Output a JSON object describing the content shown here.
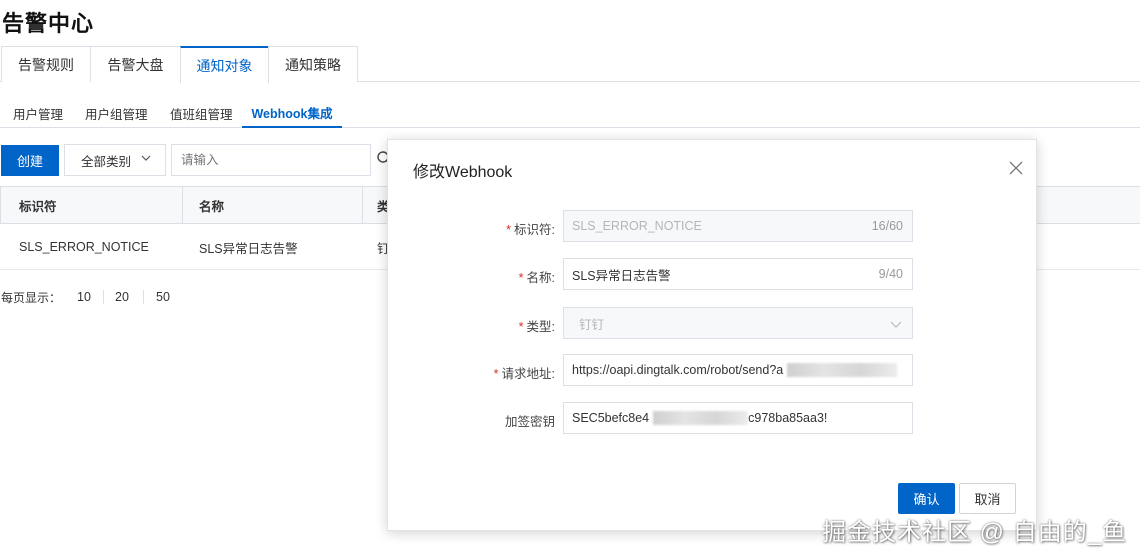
{
  "page": {
    "title": "告警中心"
  },
  "main_tabs": [
    {
      "label": "告警规则"
    },
    {
      "label": "告警大盘"
    },
    {
      "label": "通知对象",
      "active": true
    },
    {
      "label": "通知策略"
    }
  ],
  "sub_tabs": [
    {
      "label": "用户管理"
    },
    {
      "label": "用户组管理"
    },
    {
      "label": "值班组管理"
    },
    {
      "label": "Webhook集成",
      "active": true
    }
  ],
  "toolbar": {
    "create_label": "创建",
    "category_selected": "全部类别",
    "search_placeholder": "请输入"
  },
  "table": {
    "columns": [
      "标识符",
      "名称",
      "类"
    ],
    "rows": [
      [
        "SLS_ERROR_NOTICE",
        "SLS异常日志告警",
        "钉"
      ]
    ]
  },
  "pagination": {
    "label": "每页显示：",
    "options": [
      "10",
      "20",
      "50"
    ]
  },
  "dialog": {
    "title": "修改Webhook",
    "fields": {
      "identifier": {
        "label": "标识符:",
        "required": true,
        "value": "SLS_ERROR_NOTICE",
        "count": "16/60",
        "disabled": true
      },
      "name": {
        "label": "名称:",
        "required": true,
        "value": "SLS异常日志告警",
        "count": "9/40"
      },
      "type": {
        "label": "类型:",
        "required": true,
        "value": "钉钉",
        "disabled": true
      },
      "url": {
        "label": "请求地址:",
        "required": true,
        "value": "https://oapi.dingtalk.com/robot/send?a"
      },
      "secret": {
        "label": "加签密钥",
        "required": false,
        "value": "SEC5befc8e4",
        "value_tail": "c978ba85aa3!"
      }
    },
    "ok_label": "确认",
    "cancel_label": "取消"
  },
  "watermark": "掘金技术社区 @ 自由的_鱼",
  "colors": {
    "primary": "#0064c8",
    "required": "#d93026",
    "border": "#dcdfe6"
  }
}
